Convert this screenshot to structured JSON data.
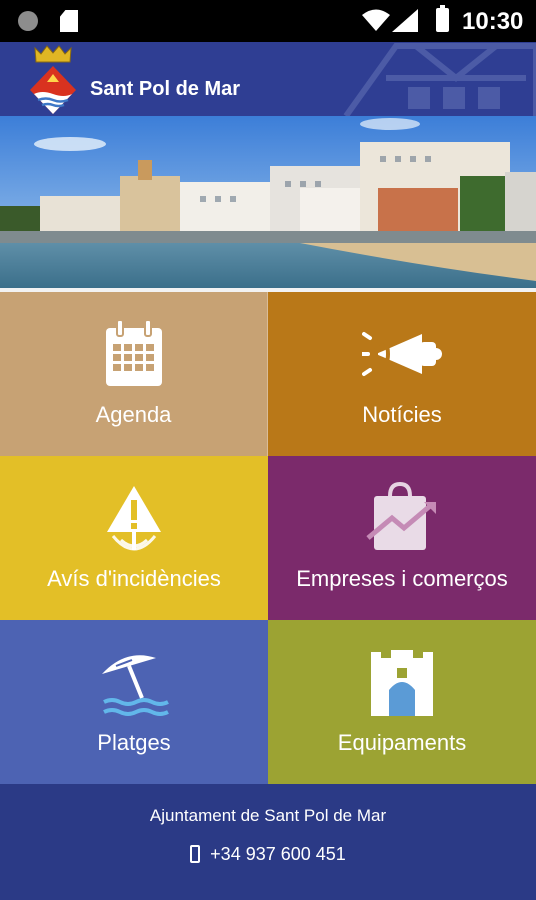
{
  "status_bar": {
    "time": "10:30"
  },
  "app": {
    "title": "Sant Pol de Mar"
  },
  "menu": [
    {
      "label": "Agenda",
      "icon": "calendar-icon",
      "color": "#c7a274"
    },
    {
      "label": "Notícies",
      "icon": "megaphone-icon",
      "color": "#b97818"
    },
    {
      "label": "Avís d'incidències",
      "icon": "warning-icon",
      "color": "#e3bf27"
    },
    {
      "label": "Empreses i comerços",
      "icon": "shopping-bag-icon",
      "color": "#7b2a6b"
    },
    {
      "label": "Platges",
      "icon": "beach-umbrella-icon",
      "color": "#4d63b3"
    },
    {
      "label": "Equipaments",
      "icon": "building-icon",
      "color": "#9ca333"
    }
  ],
  "footer": {
    "organization": "Ajuntament de Sant Pol de Mar",
    "phone": "+34 937 600 451"
  },
  "colors": {
    "header": "#2f3e93",
    "footer": "#2b3a86"
  }
}
